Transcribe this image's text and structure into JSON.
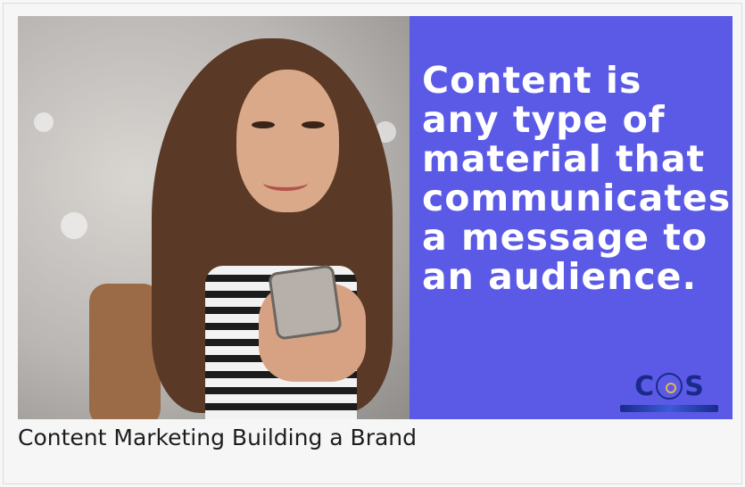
{
  "media": {
    "quote_text": "Content is any type of material that communicates a message to an audience.",
    "panel_color": "#5b5ae6",
    "photo_subject": "woman-smiling-at-phone",
    "logo_icon": "cos-logo-icon"
  },
  "caption": {
    "title": "Content Marketing Building a Brand"
  }
}
